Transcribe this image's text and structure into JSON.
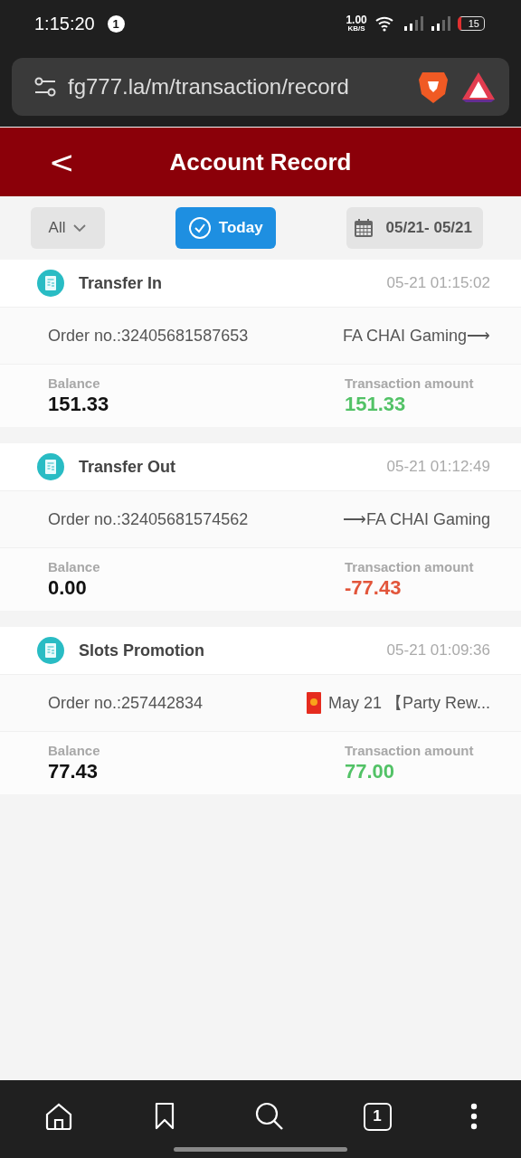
{
  "status_bar": {
    "time": "1:15:20",
    "notification_count": "1",
    "speed": "1.00",
    "speed_unit": "KB/S",
    "battery": "15"
  },
  "address_bar": {
    "url": "fg777.la/m/transaction/record"
  },
  "header": {
    "back": "<",
    "title": "Account Record"
  },
  "filters": [
    {
      "kind": "dropdown",
      "label": "All",
      "selected": false
    },
    {
      "kind": "toggle",
      "label": "Today",
      "selected": true
    },
    {
      "kind": "date",
      "label": "05/21- 05/21",
      "selected": false
    }
  ],
  "records": [
    {
      "title": "Transfer In",
      "time": "05-21 01:15:02",
      "order_label": "Order no.:",
      "order_no": "32405681587653",
      "detail": "FA CHAI Gaming⟶",
      "detail_icon": false,
      "balance_label": "Balance",
      "balance": "151.33",
      "amount_label": "Transaction amount",
      "amount": "151.33",
      "kind": "credit"
    },
    {
      "title": "Transfer Out",
      "time": "05-21 01:12:49",
      "order_label": "Order no.:",
      "order_no": "32405681574562",
      "detail": "⟶FA CHAI Gaming",
      "detail_icon": false,
      "balance_label": "Balance",
      "balance": "0.00",
      "amount_label": "Transaction amount",
      "amount": "-77.43",
      "kind": "debit"
    },
    {
      "title": "Slots Promotion",
      "time": "05-21 01:09:36",
      "order_label": "Order no.:",
      "order_no": "257442834",
      "detail": "May 21 【Party Rew...",
      "detail_icon": true,
      "balance_label": "Balance",
      "balance": "77.43",
      "amount_label": "Transaction amount",
      "amount": "77.00",
      "kind": "credit"
    }
  ],
  "nav_bar": {
    "tab_count": "1"
  }
}
